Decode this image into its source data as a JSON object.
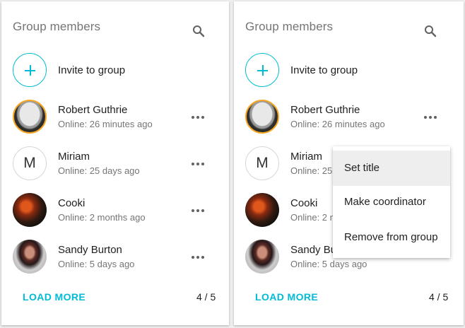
{
  "left_panel": {
    "title": "Group members",
    "invite_label": "Invite to group",
    "members": [
      {
        "name": "Robert Guthrie",
        "status": "Online: 26 minutes ago",
        "avatar": "photo"
      },
      {
        "name": "Miriam",
        "status": "Online: 25 days ago",
        "avatar": "letter",
        "initial": "M"
      },
      {
        "name": "Cooki",
        "status": "Online: 2 months ago",
        "avatar": "photo"
      },
      {
        "name": "Sandy Burton",
        "status": "Online: 5 days ago",
        "avatar": "photo"
      }
    ],
    "load_more": "LOAD MORE",
    "pager": "4 / 5"
  },
  "right_panel": {
    "title": "Group members",
    "invite_label": "Invite to group",
    "members": [
      {
        "name": "Robert Guthrie",
        "status": "Online: 26 minutes ago",
        "avatar": "photo"
      },
      {
        "name": "Miriam",
        "status": "Online: 25",
        "avatar": "letter",
        "initial": "M"
      },
      {
        "name": "Cooki",
        "status": "Online: 2 m",
        "avatar": "photo"
      },
      {
        "name": "Sandy Bur",
        "status": "Online: 5 days ago",
        "avatar": "photo"
      }
    ],
    "load_more": "LOAD MORE",
    "pager": "4 / 5"
  },
  "context_menu": {
    "items": [
      {
        "label": "Set title",
        "active": true
      },
      {
        "label": "Make coordinator",
        "active": false
      },
      {
        "label": "Remove from group",
        "active": false
      }
    ]
  },
  "icons": {
    "search": "search-icon",
    "more": "more-horizontal-icon",
    "add": "plus-icon"
  },
  "colors": {
    "accent": "#00bcd4",
    "avatar_ring": "#f5a623"
  }
}
